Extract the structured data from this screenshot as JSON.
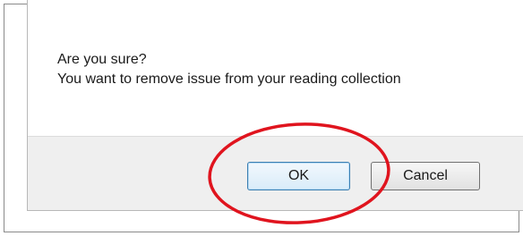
{
  "dialog": {
    "title_line": "Are you sure?",
    "message": "You want to remove issue from your reading collection",
    "ok_label": "OK",
    "cancel_label": "Cancel"
  },
  "annotation": {
    "ellipse_color": "#e0141e",
    "description": "red-circle-highlight"
  },
  "colors": {
    "button_bar": "#efefef",
    "ok_border": "#3c7fb1"
  }
}
